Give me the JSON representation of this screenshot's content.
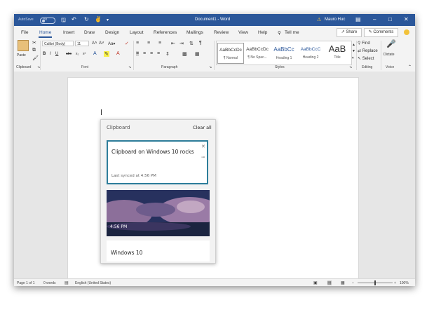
{
  "titlebar": {
    "autosave": "AutoSave",
    "autosave_state": "Off",
    "document_title": "Document1 - Word",
    "user": "Mauro Huc",
    "undo_icon": "undo-icon",
    "redo_icon": "redo-icon",
    "save_icon": "save-icon"
  },
  "tabs": [
    "File",
    "Home",
    "Insert",
    "Draw",
    "Design",
    "Layout",
    "References",
    "Mailings",
    "Review",
    "View",
    "Help"
  ],
  "tell_me": "Tell me",
  "share": "Share",
  "comments": "Comments",
  "ribbon": {
    "paste": "Paste",
    "font_name": "Calibri (Body)",
    "font_size": "11",
    "find": "Find",
    "replace": "Replace",
    "select": "Select",
    "dictate": "Dictate",
    "groups": [
      "Clipboard",
      "Font",
      "Paragraph",
      "Styles",
      "Editing",
      "Voice"
    ],
    "styles": [
      {
        "preview": "AaBbCcDc",
        "name": "¶ Normal"
      },
      {
        "preview": "AaBbCcDc",
        "name": "¶ No Spac..."
      },
      {
        "preview": "AaBbCc",
        "name": "Heading 1"
      },
      {
        "preview": "AaBbCcC",
        "name": "Heading 2"
      },
      {
        "preview": "AaB",
        "name": "Title"
      }
    ]
  },
  "clipboard": {
    "title": "Clipboard",
    "clear_all": "Clear all",
    "items": [
      {
        "text": "Clipboard on Windows 10 rocks",
        "time": "Last synced at 4:56 PM"
      },
      {
        "time": "4:56 PM"
      },
      {
        "text": "Windows 10"
      }
    ]
  },
  "status": {
    "page": "Page 1 of 1",
    "words": "0 words",
    "language": "English (United States)",
    "zoom": "100%"
  },
  "colors": {
    "accent": "#2b579a",
    "clipboard_border": "#2d7d9a"
  }
}
